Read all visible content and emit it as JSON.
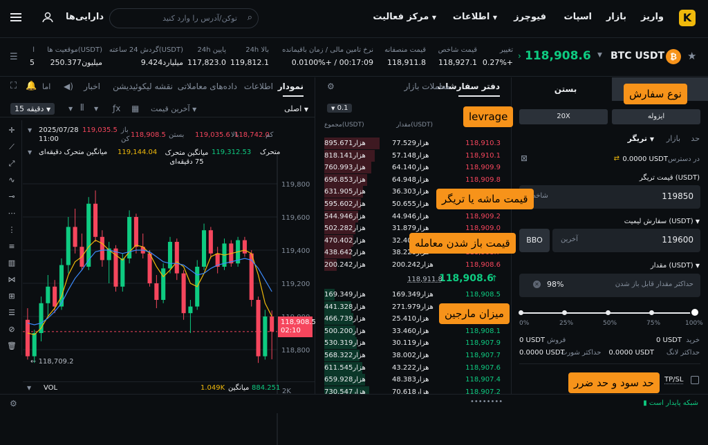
{
  "header": {
    "nav": {
      "deposit": "واریز",
      "market": "بازار",
      "spot": "اسپات",
      "futures": "فیوچرز",
      "info": "اطلاعات",
      "activity": "مرکز فعالیت",
      "assets": "دارایی‌ها"
    },
    "search_placeholder": "توکن/آدرس را وارد کنید"
  },
  "ticker": {
    "pair": "BTC USDT",
    "price": "118,908.6",
    "change_label": "تغییر",
    "change_value": "0.27%+",
    "index_label": "قیمت شاخص",
    "index_value": "118,927.1",
    "mark_label": "قیمت منصفانه",
    "mark_value": "118,911.8",
    "funding_label": "نرخ تامین مالی / زمان باقیمانده",
    "funding_value": "0.0100%+ / 00:17:09",
    "high_label": "24h بالا",
    "high_value": "119,812.1",
    "low_label": "24h پایین",
    "low_value": "117,823.0",
    "vol_label": "گردش 24 ساعته(USDT)",
    "vol_value": "9.424میلیارد",
    "oi_label": "موقعیت ها(USDT)",
    "oi_value": "250.377میلیون",
    "extra_label": "ا",
    "extra_value": "5"
  },
  "chart_panel": {
    "tabs": [
      "نمودار",
      "اطلاعات",
      "داده‌های معاملاتی",
      "نقشه لیکوئیدیشن",
      "اخبار"
    ],
    "tab_misc": "اما",
    "mode": "اصلی",
    "interval": "15 دقیقه",
    "last_price": "آخرین قیمت",
    "ohlc": {
      "date": "2025/07/28",
      "time": "11:00",
      "open_label": "باز",
      "open": "119,035.5",
      "close_label": "بستن",
      "close": "118,908.5",
      "high_label": "بالا",
      "high": "119,035.6",
      "low_label": "کم",
      "low": "118,742.0",
      "change_label": "کن"
    },
    "ma": {
      "ma1_label": "میانگین متحرک دقیقه‌ای",
      "ma1": "119,144.04",
      "ma2_label": "میانگین متحرک 75 دقیقه‌ای",
      "ma2": "119,312.53",
      "ma3_label": "متحرک"
    },
    "vol_label": "VOL",
    "vol_avg_label": "میانگین",
    "vol_avg": "1.049K",
    "vol_value": "884.251",
    "vol_axis": "2K",
    "price_tag": "118,908.5",
    "countdown": "02:10",
    "min_label": "118,709.2"
  },
  "chart_data": {
    "type": "candlestick",
    "yticks": [
      "119,800",
      "119,600",
      "119,400",
      "119,200",
      "119,000",
      "118,800"
    ],
    "ylim": [
      118650,
      119900
    ],
    "candles": [
      [
        118980,
        119050,
        118740,
        118760
      ],
      [
        118760,
        118920,
        118720,
        118900
      ],
      [
        118900,
        119120,
        118850,
        119080
      ],
      [
        119080,
        119250,
        119000,
        119180
      ],
      [
        119180,
        119220,
        119020,
        119060
      ],
      [
        119060,
        119350,
        119040,
        119310
      ],
      [
        119310,
        119600,
        119260,
        119540
      ],
      [
        119540,
        119650,
        119380,
        119420
      ],
      [
        119420,
        119500,
        119280,
        119300
      ],
      [
        119300,
        119720,
        119280,
        119680
      ],
      [
        119680,
        119760,
        119450,
        119480
      ],
      [
        119480,
        119520,
        119300,
        119340
      ],
      [
        119340,
        119450,
        119200,
        119410
      ],
      [
        119410,
        119430,
        119150,
        119180
      ],
      [
        119180,
        119380,
        119150,
        119350
      ],
      [
        119350,
        119640,
        119320,
        119600
      ],
      [
        119600,
        119620,
        119380,
        119420
      ],
      [
        119420,
        119500,
        119350,
        119380
      ],
      [
        119380,
        119400,
        119180,
        119200
      ],
      [
        119200,
        119250,
        119050,
        119100
      ],
      [
        119100,
        119320,
        119080,
        119290
      ],
      [
        119290,
        119480,
        119260,
        119450
      ],
      [
        119450,
        119470,
        119220,
        119260
      ],
      [
        119260,
        119280,
        118980,
        119020
      ],
      [
        119020,
        119100,
        118900,
        119060
      ],
      [
        119060,
        119340,
        119040,
        119300
      ],
      [
        119300,
        119560,
        119280,
        119520
      ],
      [
        119520,
        119540,
        119350,
        119380
      ],
      [
        119380,
        119420,
        119260,
        119300
      ],
      [
        119300,
        119470,
        119280,
        119440
      ],
      [
        119440,
        119460,
        119300,
        119320
      ],
      [
        119320,
        119480,
        119300,
        119460
      ],
      [
        119460,
        119480,
        119360,
        119380
      ],
      [
        119380,
        119400,
        119060,
        119100
      ],
      [
        119100,
        119120,
        118720,
        118760
      ],
      [
        118760,
        119040,
        118740,
        119000
      ],
      [
        119000,
        119036,
        118742,
        118909
      ]
    ],
    "ma_fast": [
      118900,
      118890,
      118930,
      119000,
      119050,
      119120,
      119250,
      119330,
      119360,
      119420,
      119460,
      119440,
      119400,
      119370,
      119340,
      119390,
      119430,
      119420,
      119380,
      119300,
      119240,
      119280,
      119330,
      119300,
      119200,
      119180,
      119260,
      119360,
      119380,
      119370,
      119380,
      119390,
      119400,
      119380,
      119250,
      119080,
      119000
    ],
    "ma_slow": [
      118960,
      118950,
      118960,
      118990,
      119030,
      119080,
      119160,
      119230,
      119280,
      119340,
      119390,
      119400,
      119400,
      119390,
      119380,
      119390,
      119400,
      119400,
      119390,
      119360,
      119330,
      119320,
      119320,
      119310,
      119280,
      119250,
      119260,
      119290,
      119310,
      119320,
      119330,
      119340,
      119350,
      119340,
      119290,
      119220,
      119150
    ]
  },
  "orderbook": {
    "tabs": [
      "دفتر سفارشات",
      "معاملات بازار"
    ],
    "step": "0.1",
    "headers": {
      "price": "(USDT)",
      "amount": "مقدار(USDT)",
      "total": "مجموع(USDT)"
    },
    "asks": [
      [
        "118,910.3",
        "77.529هزار",
        "895.671هزار"
      ],
      [
        "118,910.1",
        "57.148هزار",
        "818.141هزار"
      ],
      [
        "118,909.9",
        "64.140هزار",
        "760.993هزار"
      ],
      [
        "118,909.8",
        "64.948هزار",
        "696.853هزار"
      ],
      [
        "118,909.7",
        "36.303هزار",
        "631.905هزار"
      ],
      [
        "118,909.5",
        "50.655هزار",
        "595.602هزار"
      ],
      [
        "118,909.2",
        "44.946هزار",
        "544.946هزار"
      ],
      [
        "118,909.0",
        "31.879هزار",
        "502.282هزار"
      ],
      [
        "118,908.8",
        "32.400هزار",
        "470.402هزار"
      ],
      [
        "118,908.7",
        "38.220هزار",
        "438.642هزار"
      ],
      [
        "118,908.6",
        "200.242هزار",
        "200.242هزار"
      ]
    ],
    "last_price": "118,908.6",
    "mark_price": "118,911.8",
    "bids": [
      [
        "118,908.5",
        "169.349هزار",
        "169.349هزار"
      ],
      [
        "118,908.4",
        "271.979هزار",
        "441.328هزار"
      ],
      [
        "118,908.3",
        "25.410هزار",
        "466.739هزار"
      ],
      [
        "118,908.1",
        "33.460هزار",
        "500.200هزار"
      ],
      [
        "118,907.9",
        "30.119هزار",
        "530.319هزار"
      ],
      [
        "118,907.7",
        "38.002هزار",
        "568.322هزار"
      ],
      [
        "118,907.6",
        "43.222هزار",
        "611.545هزار"
      ],
      [
        "118,907.4",
        "48.383هزار",
        "659.928هزار"
      ],
      [
        "118,907.2",
        "70.618هزار",
        "730.547هزار"
      ]
    ]
  },
  "order_form": {
    "tabs": [
      "باز",
      "بستن"
    ],
    "margin_mode": "ایزوله",
    "leverage": "20X",
    "types": [
      "حد",
      "بازار",
      "تریگر"
    ],
    "available_label": "در دسترس",
    "available": "0.0000 USDT",
    "trigger_label": "قیمت تریگر (USDT)",
    "trigger_value": "119850",
    "trigger_hint": "شاخص",
    "limit_label": "سفارش لیمیت (USDT)",
    "limit_value": "119600",
    "limit_hint": "آخرین",
    "bbo": "BBO",
    "qty_label": "مقدار (USDT)",
    "qty_placeholder": "حداکثر مقدار قابل باز شدن",
    "qty_percent": "98%",
    "slider": {
      "value": 1.0,
      "marks": [
        "0%",
        "25%",
        "50%",
        "75%",
        "100%"
      ]
    },
    "buy_label": "خرید",
    "buy_value": "0 USDT",
    "sell_label": "فروش",
    "sell_value": "0 USDT",
    "max_long_label": "حداکثر لانگ",
    "max_long": "0.0000 USDT",
    "max_short_label": "حداکثر شورت",
    "max_short": "0.0000 USDT",
    "tpsl": "TP/SL"
  },
  "callouts": {
    "order_type": "نوع سفارش",
    "leverage": "levrage",
    "trigger": "قیمت ماشه یا تریگر",
    "open_price": "قیمت باز شدن معامله",
    "margin": "میزان مارجین",
    "tpsl": "حد سود و حد ضرر"
  },
  "footer": {
    "network": "شبکه پایدار است"
  },
  "colors": {
    "up": "#0ecb81",
    "down": "#f6465d",
    "callout": "#f7931a",
    "ma_fast": "#f0b90b",
    "ma_slow": "#3d8bfd"
  }
}
